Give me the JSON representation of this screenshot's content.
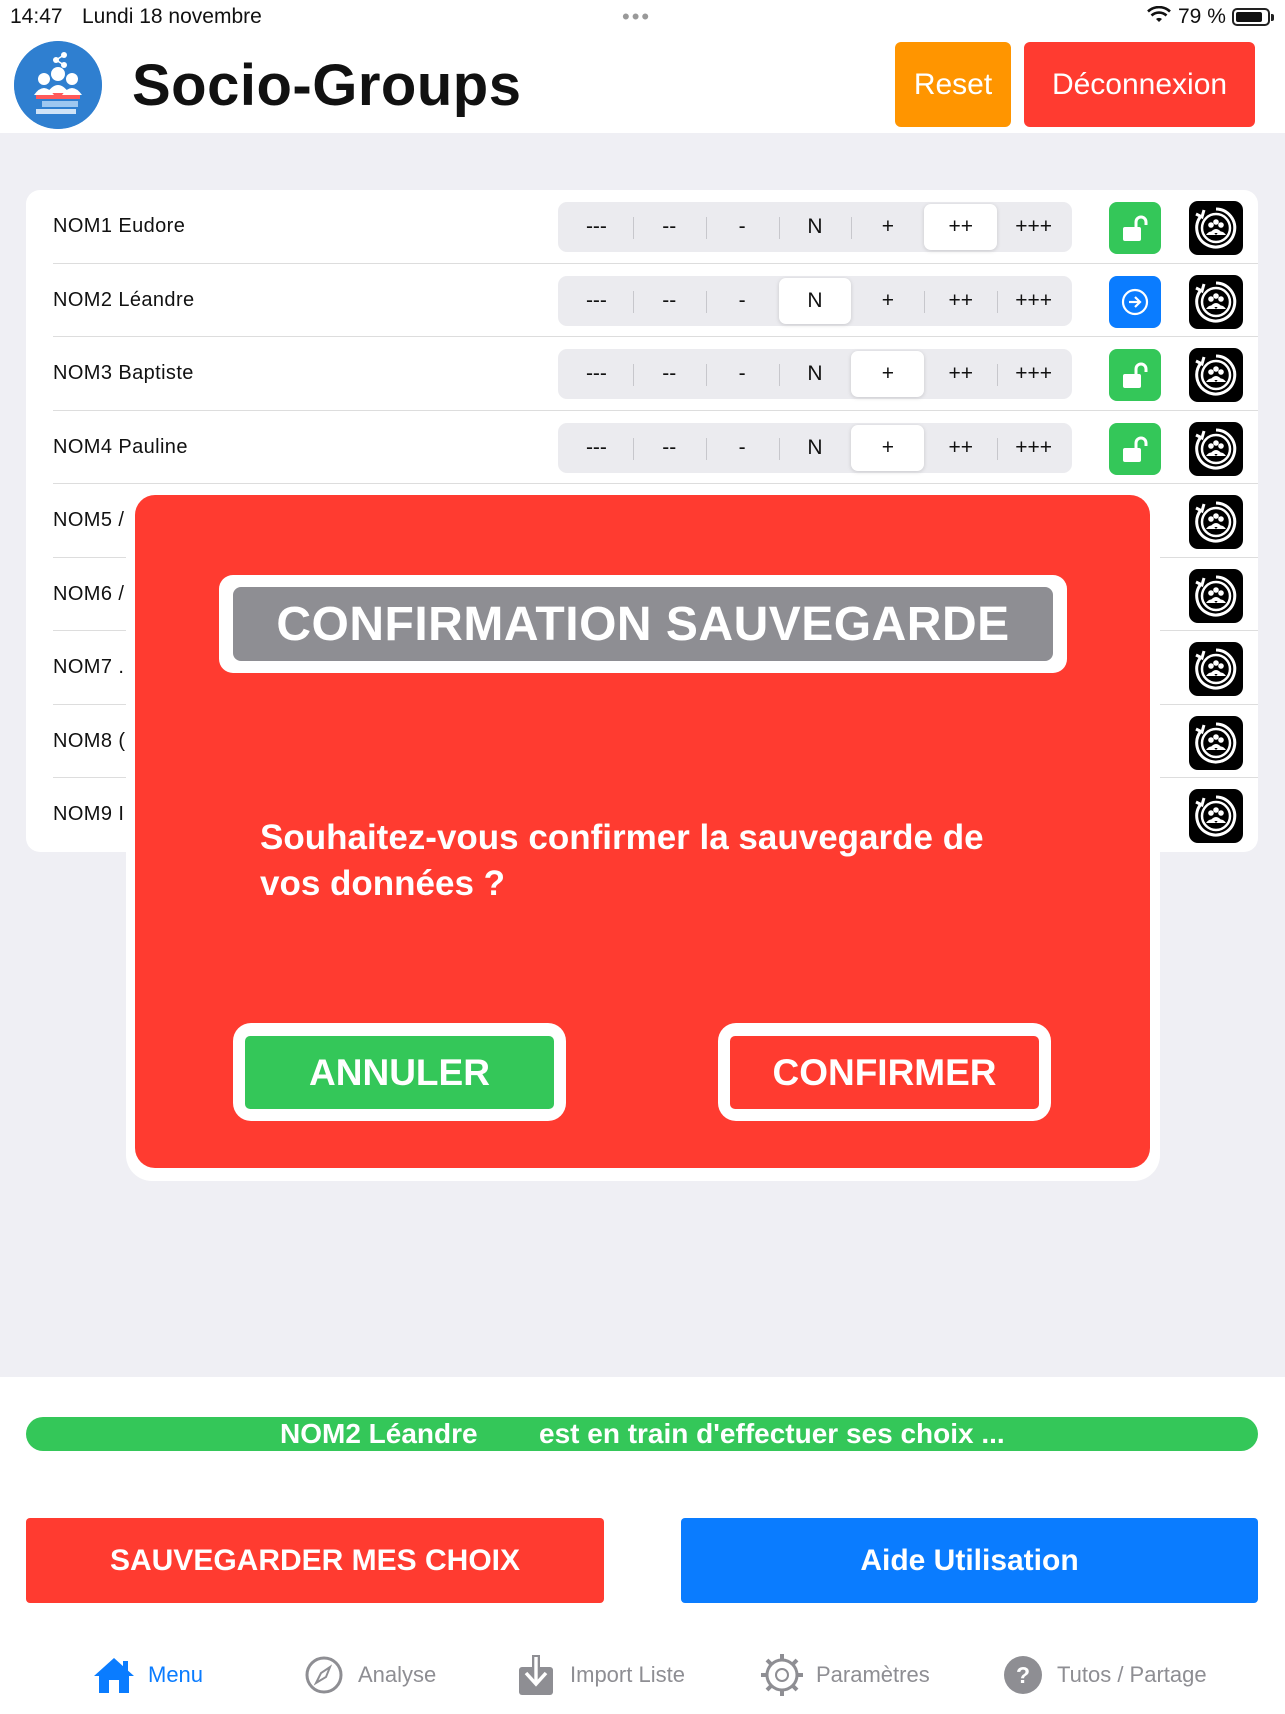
{
  "status_bar": {
    "time": "14:47",
    "date": "Lundi 18 novembre",
    "battery": "79 %"
  },
  "header": {
    "title": "Socio-Groups",
    "reset_label": "Reset",
    "logout_label": "Déconnexion"
  },
  "colors": {
    "green": "#34c759",
    "red": "#ff3b30",
    "orange": "#ff9500",
    "blue": "#0a7cff",
    "gray": "#8e8e93"
  },
  "options": [
    "---",
    "--",
    "-",
    "N",
    "+",
    "++",
    "+++"
  ],
  "students": [
    {
      "name": "NOM1 Eudore",
      "selected": 5,
      "status": "unlocked",
      "status_icon": "unlock-icon"
    },
    {
      "name": "NOM2 Léandre",
      "selected": 3,
      "status": "current",
      "status_icon": "arrow-right-circle-icon"
    },
    {
      "name": "NOM3 Baptiste",
      "selected": 4,
      "status": "unlocked",
      "status_icon": "unlock-icon"
    },
    {
      "name": "NOM4 Pauline",
      "selected": 4,
      "status": "unlocked",
      "status_icon": "unlock-icon"
    },
    {
      "name": "NOM5 /"
    },
    {
      "name": "NOM6 /"
    },
    {
      "name": "NOM7 ."
    },
    {
      "name": "NOM8 ("
    },
    {
      "name": "NOM9 I"
    }
  ],
  "modal": {
    "title": "CONFIRMATION SAUVEGARDE",
    "message": "Souhaitez-vous confirmer la sauvegarde de vos données ?",
    "cancel_label": "ANNULER",
    "confirm_label": "CONFIRMER"
  },
  "progress": {
    "who": "NOM2 Léandre",
    "what": "est en train d'effectuer ses choix ..."
  },
  "actions": {
    "save_label": "SAUVEGARDER MES CHOIX",
    "help_label": "Aide Utilisation"
  },
  "tabs": [
    {
      "label": "Menu",
      "icon": "home-icon",
      "active": true
    },
    {
      "label": "Analyse",
      "icon": "compass-icon",
      "active": false
    },
    {
      "label": "Import Liste",
      "icon": "download-icon",
      "active": false
    },
    {
      "label": "Paramètres",
      "icon": "gear-icon",
      "active": false
    },
    {
      "label": "Tutos / Partage",
      "icon": "question-icon",
      "active": false
    }
  ]
}
